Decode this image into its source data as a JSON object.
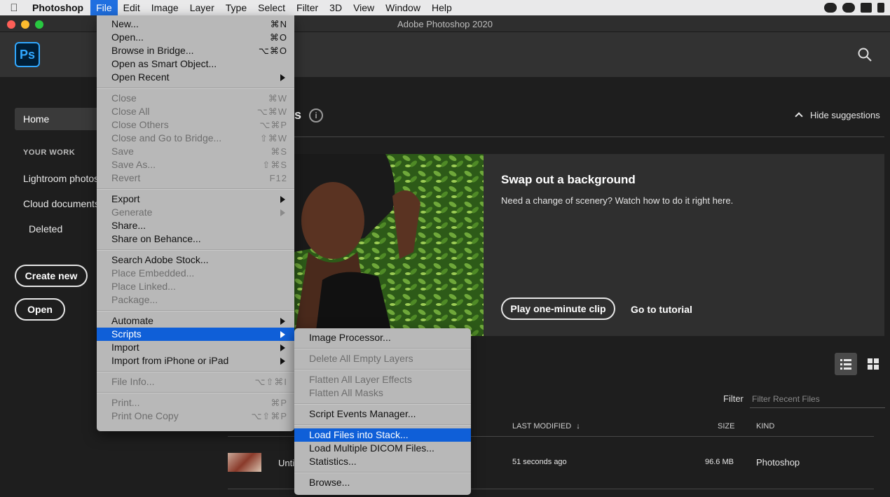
{
  "menubar": {
    "app_name": "Photoshop",
    "items": [
      "File",
      "Edit",
      "Image",
      "Layer",
      "Type",
      "Select",
      "Filter",
      "3D",
      "View",
      "Window",
      "Help"
    ]
  },
  "window": {
    "title": "Adobe Photoshop 2020"
  },
  "header": {
    "logo": "Ps"
  },
  "sidebar": {
    "home": "Home",
    "your_work_label": "YOUR WORK",
    "items": [
      "Lightroom photos",
      "Cloud documents",
      "Deleted"
    ],
    "create_new": "Create new",
    "open": "Open"
  },
  "suggestions": {
    "title_fragment": "s",
    "hide_label": "Hide suggestions",
    "card_title": "Swap out a background",
    "card_desc": "Need a change of scenery? Watch how to do it right here.",
    "play_label": "Play one-minute clip",
    "tutorial_label": "Go to tutorial"
  },
  "recent": {
    "filter_label": "Filter",
    "filter_placeholder": "Filter Recent Files",
    "columns": {
      "modified": "LAST MODIFIED",
      "size": "SIZE",
      "kind": "KIND"
    },
    "rows": [
      {
        "name": "Unti",
        "modified": "51 seconds ago",
        "size": "96.6 MB",
        "kind": "Photoshop"
      }
    ]
  },
  "file_menu": {
    "groups": [
      [
        {
          "label": "New...",
          "shortcut": "⌘N",
          "disabled": false
        },
        {
          "label": "Open...",
          "shortcut": "⌘O",
          "disabled": false
        },
        {
          "label": "Browse in Bridge...",
          "shortcut": "⌥⌘O",
          "disabled": false
        },
        {
          "label": "Open as Smart Object...",
          "shortcut": "",
          "disabled": false
        },
        {
          "label": "Open Recent",
          "submenu": true,
          "disabled": false
        }
      ],
      [
        {
          "label": "Close",
          "shortcut": "⌘W",
          "disabled": true
        },
        {
          "label": "Close All",
          "shortcut": "⌥⌘W",
          "disabled": true
        },
        {
          "label": "Close Others",
          "shortcut": "⌥⌘P",
          "disabled": true
        },
        {
          "label": "Close and Go to Bridge...",
          "shortcut": "⇧⌘W",
          "disabled": true
        },
        {
          "label": "Save",
          "shortcut": "⌘S",
          "disabled": true
        },
        {
          "label": "Save As...",
          "shortcut": "⇧⌘S",
          "disabled": true
        },
        {
          "label": "Revert",
          "shortcut": "F12",
          "disabled": true
        }
      ],
      [
        {
          "label": "Export",
          "submenu": true,
          "disabled": false
        },
        {
          "label": "Generate",
          "submenu": true,
          "disabled": true
        },
        {
          "label": "Share...",
          "shortcut": "",
          "disabled": false
        },
        {
          "label": "Share on Behance...",
          "shortcut": "",
          "disabled": false
        }
      ],
      [
        {
          "label": "Search Adobe Stock...",
          "shortcut": "",
          "disabled": false
        },
        {
          "label": "Place Embedded...",
          "shortcut": "",
          "disabled": true
        },
        {
          "label": "Place Linked...",
          "shortcut": "",
          "disabled": true
        },
        {
          "label": "Package...",
          "shortcut": "",
          "disabled": true
        }
      ],
      [
        {
          "label": "Automate",
          "submenu": true,
          "disabled": false
        },
        {
          "label": "Scripts",
          "submenu": true,
          "disabled": false,
          "selected": true
        },
        {
          "label": "Import",
          "submenu": true,
          "disabled": false
        },
        {
          "label": "Import from iPhone or iPad",
          "submenu": true,
          "disabled": false
        }
      ],
      [
        {
          "label": "File Info...",
          "shortcut": "⌥⇧⌘I",
          "disabled": true
        }
      ],
      [
        {
          "label": "Print...",
          "shortcut": "⌘P",
          "disabled": true
        },
        {
          "label": "Print One Copy",
          "shortcut": "⌥⇧⌘P",
          "disabled": true
        }
      ]
    ]
  },
  "scripts_menu": {
    "groups": [
      [
        {
          "label": "Image Processor...",
          "disabled": false
        }
      ],
      [
        {
          "label": "Delete All Empty Layers",
          "disabled": true
        }
      ],
      [
        {
          "label": "Flatten All Layer Effects",
          "disabled": true
        },
        {
          "label": "Flatten All Masks",
          "disabled": true
        }
      ],
      [
        {
          "label": "Script Events Manager...",
          "disabled": false
        }
      ],
      [
        {
          "label": "Load Files into Stack...",
          "disabled": false,
          "selected": true
        },
        {
          "label": "Load Multiple DICOM Files...",
          "disabled": false
        },
        {
          "label": "Statistics...",
          "disabled": false
        }
      ],
      [
        {
          "label": "Browse...",
          "disabled": false
        }
      ]
    ]
  },
  "colors": {
    "accent": "#0f5fd8",
    "ps_blue": "#31a8ff",
    "background": "#1e1e1e"
  }
}
